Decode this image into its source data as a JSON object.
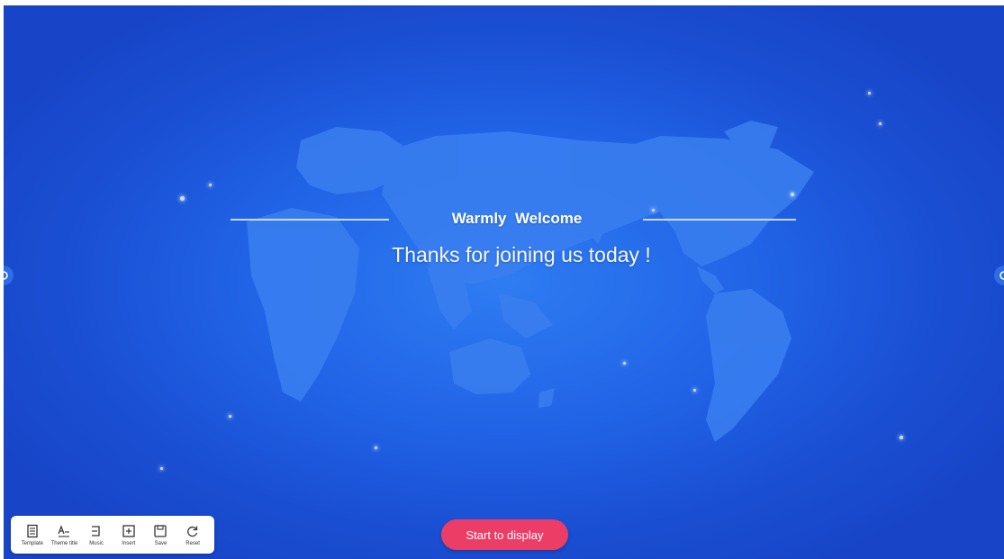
{
  "welcome": {
    "title": "Warmly  Welcome",
    "subtitle": "Thanks for joining us today !"
  },
  "toolbar": {
    "items": [
      {
        "label": "Template",
        "icon": "template-icon"
      },
      {
        "label": "Theme title",
        "icon": "theme-title-icon"
      },
      {
        "label": "Music",
        "icon": "music-icon"
      },
      {
        "label": "Insert",
        "icon": "insert-icon"
      },
      {
        "label": "Save",
        "icon": "save-icon"
      },
      {
        "label": "Reset",
        "icon": "reset-icon"
      }
    ]
  },
  "start_button": {
    "label": "Start to display"
  },
  "colors": {
    "background": "#2163e6",
    "accent_button": "#ec3d66",
    "map": "#3d82f0"
  }
}
